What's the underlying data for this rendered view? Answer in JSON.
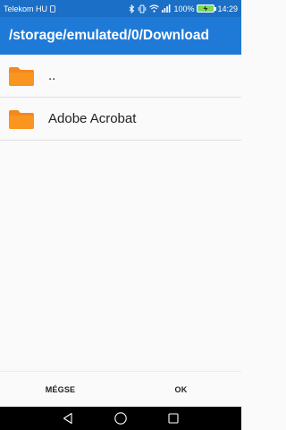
{
  "status_bar": {
    "carrier": "Telekom HU",
    "battery_percent": "100%",
    "time": "14:29",
    "icons": [
      "bluetooth-icon",
      "vibrate-icon",
      "wifi-icon",
      "signal-icon",
      "battery-icon"
    ]
  },
  "app_bar": {
    "path": "/storage/emulated/0/Download"
  },
  "files": [
    {
      "name": "..",
      "icon": "folder-icon"
    },
    {
      "name": "Adobe Acrobat",
      "icon": "folder-icon"
    }
  ],
  "dialog": {
    "cancel_label": "MÉGSE",
    "ok_label": "OK"
  },
  "nav_bar": {
    "icons": [
      "back-icon",
      "home-icon",
      "recents-icon"
    ]
  },
  "colors": {
    "status_bar": "#1b6fc6",
    "app_bar": "#1f7ad7",
    "folder": "#f5871f"
  }
}
